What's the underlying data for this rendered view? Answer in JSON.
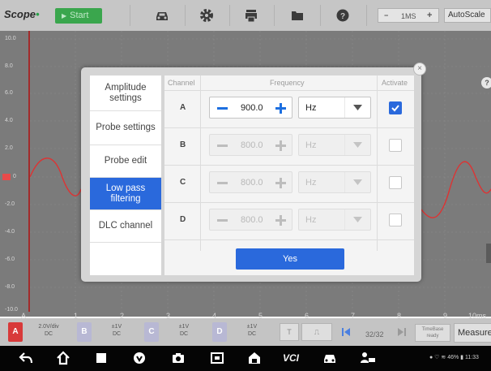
{
  "toolbar": {
    "logo": "Scope",
    "start_label": "Start",
    "zoom_value": "1MS",
    "zoom_minus": "−",
    "zoom_plus": "+",
    "autoscale_label": "AutoScale",
    "icons": [
      "car-icon",
      "gear-icon",
      "printer-icon",
      "folder-icon",
      "help-icon"
    ]
  },
  "scope": {
    "y_labels": [
      "10.0",
      "8.0",
      "6.0",
      "4.0",
      "2.0",
      "0",
      "-2.0",
      "-4.0",
      "-6.0",
      "-8.0",
      "-10.0"
    ],
    "x_labels": [
      "A",
      "1",
      "2",
      "3",
      "4",
      "5",
      "6",
      "7",
      "8",
      "9",
      "10ms"
    ],
    "help_label": "?"
  },
  "dialog": {
    "close_label": "×",
    "tabs": [
      {
        "label": "Amplitude settings",
        "active": false
      },
      {
        "label": "Probe settings",
        "active": false
      },
      {
        "label": "Probe edit",
        "active": false
      },
      {
        "label": "Low pass filtering",
        "active": true
      },
      {
        "label": "DLC channel",
        "active": false
      }
    ],
    "headers": {
      "channel": "Channel",
      "frequency": "Frequency",
      "activate": "Activate"
    },
    "rows": [
      {
        "channel": "A",
        "value": "900.0",
        "unit": "Hz",
        "checked": true,
        "enabled": true
      },
      {
        "channel": "B",
        "value": "800.0",
        "unit": "Hz",
        "checked": false,
        "enabled": false
      },
      {
        "channel": "C",
        "value": "800.0",
        "unit": "Hz",
        "checked": false,
        "enabled": false
      },
      {
        "channel": "D",
        "value": "800.0",
        "unit": "Hz",
        "checked": false,
        "enabled": false
      }
    ],
    "yes_label": "Yes"
  },
  "statusbar": {
    "channels": [
      {
        "letter": "A",
        "color": "#d83a3a",
        "line1": "2.0V/div",
        "line2": "DC"
      },
      {
        "letter": "B",
        "color": "#b8b8d4",
        "line1": "±1V",
        "line2": "DC"
      },
      {
        "letter": "C",
        "color": "#b8b8d4",
        "line1": "±1V",
        "line2": "DC"
      },
      {
        "letter": "D",
        "color": "#b8b8d4",
        "line1": "±1V",
        "line2": "DC"
      }
    ],
    "t_label": "T",
    "pulse_label": "⎍",
    "pager": "32/32",
    "timebase_line1": "TimeBase",
    "timebase_line2": "ready",
    "measure_label": "Measure"
  },
  "navbar": {
    "vci_label": "VCI",
    "status": "● ♡ ≋ 46% ▮ 11:33"
  }
}
